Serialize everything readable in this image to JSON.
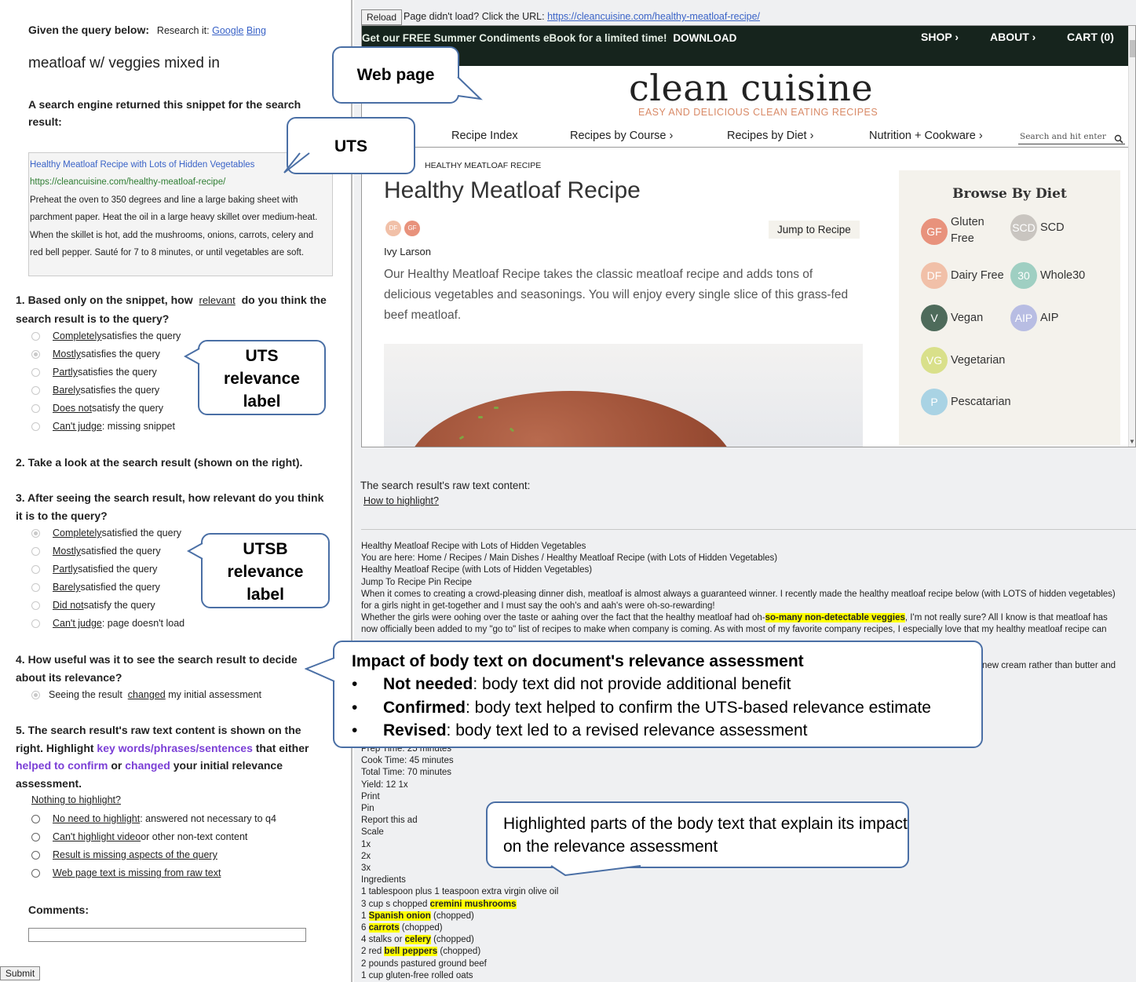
{
  "left": {
    "intro": "Given the query below:",
    "research_label": "Research it:",
    "research_links": [
      "Google",
      "Bing"
    ],
    "query": "meatloaf w/ veggies mixed in",
    "snippet_intro": "A search engine returned this snippet for the search result:",
    "snippet": {
      "title": "Healthy Meatloaf Recipe with Lots of Hidden Vegetables",
      "url": "https://cleancuisine.com/healthy-meatloaf-recipe/",
      "lines": [
        "Preheat the oven to 350 degrees and line a large baking sheet with",
        "parchment paper. Heat the oil in a large heavy skillet over medium-heat.",
        "When the skillet is hot, add the mushrooms, onions, carrots, celery and",
        "red bell pepper. Sauté for 7 to 8 minutes, or until vegetables are soft."
      ]
    },
    "q1": {
      "prefix": "1. Based only on the snippet, how",
      "link": "relevant",
      "suffix": "do you think the",
      "line2": "search result is to the query?",
      "options": [
        {
          "u": "Completely",
          "rest": " satisfies the query"
        },
        {
          "u": "Mostly",
          "rest": " satisfies the query"
        },
        {
          "u": "Partly",
          "rest": " satisfies the query"
        },
        {
          "u": "Barely",
          "rest": " satisfies the query"
        },
        {
          "u": "Does not",
          "rest": " satisfy the query"
        },
        {
          "u": "Can't judge",
          "rest": ": missing snippet"
        }
      ]
    },
    "q2": "2. Take a look at the search result (shown on the right).",
    "q3": {
      "line1": "3. After seeing the search result, how relevant do you think",
      "line2": "it is to the query?",
      "options": [
        {
          "u": "Completely",
          "rest": " satisfied the query"
        },
        {
          "u": "Mostly",
          "rest": " satisfied the query"
        },
        {
          "u": "Partly",
          "rest": " satisfied the query"
        },
        {
          "u": "Barely",
          "rest": " satisfied the query"
        },
        {
          "u": "Did not",
          "rest": " satisfy the query"
        },
        {
          "u": "Can't judge",
          "rest": ": page doesn't load"
        }
      ]
    },
    "q4": {
      "line1": "4. How useful was it to see the search result to decide",
      "line2": "about its relevance?",
      "option_prefix": "Seeing the result",
      "option_link": "changed",
      "option_suffix": "my initial assessment"
    },
    "q5": {
      "line1": "5. The search result's raw text content is shown on the",
      "line2_a": "right. Highlight",
      "line2_b": "key words/phrases/sentences",
      "line2_c": "that either",
      "line3_a": "helped to confirm",
      "line3_b": "or",
      "line3_c": "changed",
      "line3_d": "your initial relevance",
      "line4": "assessment.",
      "nothing": "Nothing to highlight?",
      "options": [
        {
          "u": "No need to highlight",
          "rest": ": answered not necessary to q4"
        },
        {
          "u": "Can't highlight video",
          "rest": " or other non-text content"
        },
        {
          "u": "Result is missing aspects of the query",
          "rest": ""
        },
        {
          "u": "Web page text is missing from raw text",
          "rest": ""
        }
      ]
    },
    "comments_label": "Comments:",
    "submit": "Submit"
  },
  "right": {
    "reload": "Reload",
    "no_load": "Page didn't load? Click the URL:",
    "url": "https://cleancuisine.com/healthy-meatloaf-recipe/",
    "site": {
      "promo": "Get our FREE Summer Condiments eBook for a limited time!",
      "promo_link": "DOWNLOAD",
      "top_nav": [
        "SHOP ›",
        "ABOUT ›",
        "CART (0)"
      ],
      "logo": "clean cuisine",
      "tagline": "EASY AND DELICIOUS CLEAN EATING RECIPES",
      "nav": [
        "Recipe Index",
        "Recipes by Course ›",
        "Recipes by Diet ›",
        "Nutrition + Cookware ›"
      ],
      "search_placeholder": "Search and hit enter",
      "breadcrumb": "HEALTHY MEATLOAF RECIPE",
      "title": "Healthy Meatloaf Recipe",
      "badges": [
        "DF",
        "GF"
      ],
      "jump": "Jump to Recipe",
      "author": "Ivy Larson",
      "intro": "Our Healthy Meatloaf Recipe takes the classic meatloaf recipe and adds tons of delicious vegetables and seasonings. You will enjoy every single slice of this grass-fed beef meatloaf.",
      "browse_title": "Browse By Diet",
      "diets": [
        {
          "abbr": "GF",
          "label": "Gluten Free",
          "color": "#e8927c"
        },
        {
          "abbr": "SCD",
          "label": "SCD",
          "color": "#c9c5c0"
        },
        {
          "abbr": "DF",
          "label": "Dairy Free",
          "color": "#f1c0a8"
        },
        {
          "abbr": "30",
          "label": "Whole30",
          "color": "#9fcfc2"
        },
        {
          "abbr": "V",
          "label": "Vegan",
          "color": "#4e6b5b"
        },
        {
          "abbr": "AIP",
          "label": "AIP",
          "color": "#b8bde3"
        },
        {
          "abbr": "VG",
          "label": "Vegetarian",
          "color": "#d9e08a"
        },
        {
          "abbr": "P",
          "label": "Pescatarian",
          "color": "#a9d3e4"
        }
      ]
    },
    "raw_label": "The search result's raw text content:",
    "how_to": "How to highlight?",
    "raw_top": [
      "Healthy Meatloaf Recipe with Lots of Hidden Vegetables",
      "You are here: Home / Recipes / Main Dishes / Healthy Meatloaf Recipe (with Lots of Hidden Vegetables)",
      "Healthy Meatloaf Recipe (with Lots of Hidden Vegetables)",
      "Jump To Recipe Pin Recipe",
      "When it comes to creating a crowd-pleasing dinner dish, meatloaf is almost always a guaranteed winner. I recently made the healthy meatloaf recipe below (with LOTS of hidden vegetables)",
      "for a girls night in get-together and I must say the ooh's and aah's were oh-so-rewarding!"
    ],
    "raw_whether_a": "Whether the girls were oohing over the taste or aahing over the fact that the healthy meatloaf had oh-",
    "raw_whether_hl": "so-many non-detectable veggies",
    "raw_whether_b": ", I'm not really sure? All I know is that meatloaf has",
    "raw_now": "now officially been added to my \"go to\" list of recipes to make when company is coming. As with most of my favorite company recipes, I especially love that my healthy meatloaf recipe can",
    "raw_cream": "new cream rather than butter and",
    "raw_mid": [
      "Prep Time: 25 minutes",
      "Cook Time: 45 minutes",
      "Total Time: 70 minutes",
      "Yield: 12 1x",
      "Print",
      "Pin",
      "Report this ad",
      "Scale",
      "1x",
      "2x",
      "3x",
      "Ingredients",
      "1 tablespoon plus 1 teaspoon extra virgin olive oil"
    ],
    "raw_ingredients": [
      {
        "a": "3 cup s chopped ",
        "hl": "cremini mushrooms",
        "b": ""
      },
      {
        "a": "1 ",
        "hl": "Spanish onion",
        "b": " (chopped)"
      },
      {
        "a": "6 ",
        "hl": "carrots",
        "b": " (chopped)"
      },
      {
        "a": "4 stalks or ",
        "hl": "celery",
        "b": " (chopped)"
      },
      {
        "a": "2 red ",
        "hl": "bell peppers",
        "b": " (chopped)"
      },
      {
        "a": "2 pounds pastured ground beef",
        "hl": "",
        "b": ""
      },
      {
        "a": "1 cup gluten-free rolled oats",
        "hl": "",
        "b": ""
      }
    ]
  },
  "callouts": {
    "web_page": "Web page",
    "uts": "UTS",
    "uts_label": [
      "UTS",
      "relevance",
      "label"
    ],
    "utsb_label": [
      "UTSB",
      "relevance",
      "label"
    ],
    "impact_title": "Impact of body text on document's relevance assessment",
    "impact_items": [
      {
        "term": "Not needed",
        "desc": ": body text did not provide additional benefit"
      },
      {
        "term": "Confirmed",
        "desc": ": body text helped to confirm the UTS-based relevance estimate"
      },
      {
        "term": "Revised",
        "desc": ": body text led to a revised relevance assessment"
      }
    ],
    "highlight": "Highlighted parts of the body text that explain its impact on the relevance assessment"
  }
}
